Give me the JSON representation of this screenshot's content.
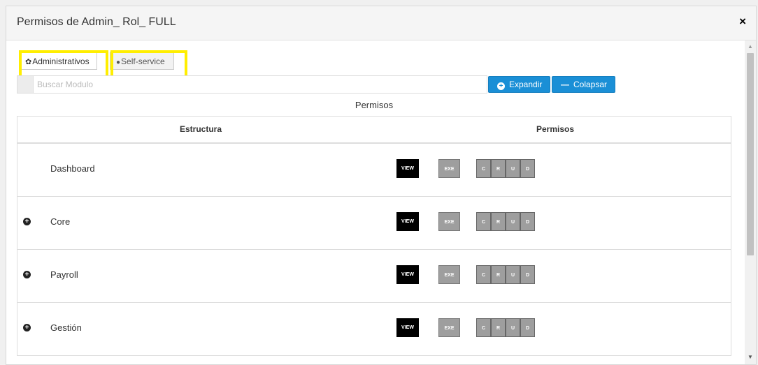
{
  "modal": {
    "title": "Permisos de Admin_ Rol_ FULL",
    "close_icon": "×"
  },
  "tabs": [
    {
      "label": "Administrativos",
      "icon": "gear-icon",
      "glyph": "✿",
      "active": true
    },
    {
      "label": "Self-service",
      "icon": "user-icon",
      "glyph": "👤",
      "active": false
    }
  ],
  "search": {
    "placeholder": "Buscar Modulo",
    "value": ""
  },
  "buttons": {
    "expand": "Expandir",
    "collapse": "Colapsar"
  },
  "caption": "Permisos",
  "table": {
    "headers": {
      "estructura": "Estructura",
      "permisos": "Permisos"
    },
    "rows": [
      {
        "name": "Dashboard",
        "expandable": false
      },
      {
        "name": "Core",
        "expandable": true
      },
      {
        "name": "Payroll",
        "expandable": true
      },
      {
        "name": "Gestión",
        "expandable": true
      }
    ],
    "perm_labels": {
      "view": "VIEW",
      "exe": "EXE",
      "c": "C",
      "r": "R",
      "u": "U",
      "d": "D"
    }
  },
  "colors": {
    "highlight": "#ffee00",
    "primary": "#1a8fd6",
    "view_active": "#000000",
    "perm_inactive": "#9e9e9e"
  }
}
